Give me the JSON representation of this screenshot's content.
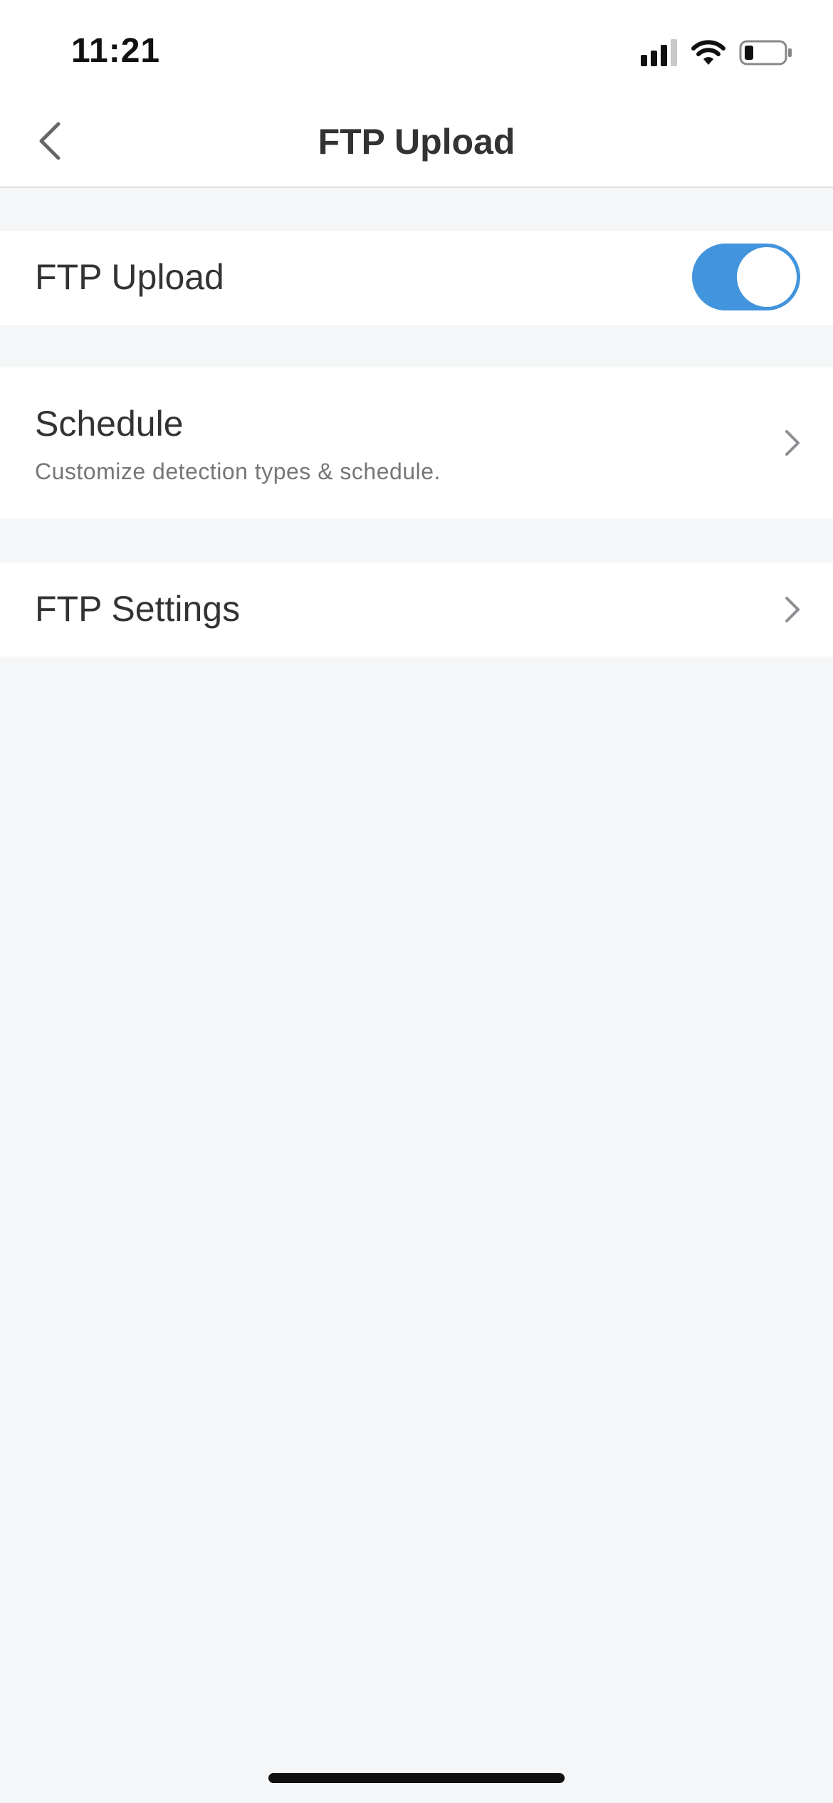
{
  "status_bar": {
    "time": "11:21",
    "icons": [
      "cellular-signal-icon",
      "wifi-icon",
      "battery-icon"
    ]
  },
  "nav": {
    "title": "FTP Upload",
    "back_icon": "chevron-left-icon"
  },
  "settings": {
    "ftp_upload": {
      "label": "FTP Upload",
      "enabled": true
    },
    "schedule": {
      "label": "Schedule",
      "description": "Customize detection types & schedule."
    },
    "ftp_settings": {
      "label": "FTP Settings"
    }
  },
  "colors": {
    "accent": "#4294dc",
    "background": "#f5f6f8",
    "surface": "#ffffff",
    "text_primary": "#333333",
    "text_secondary": "#767676"
  }
}
